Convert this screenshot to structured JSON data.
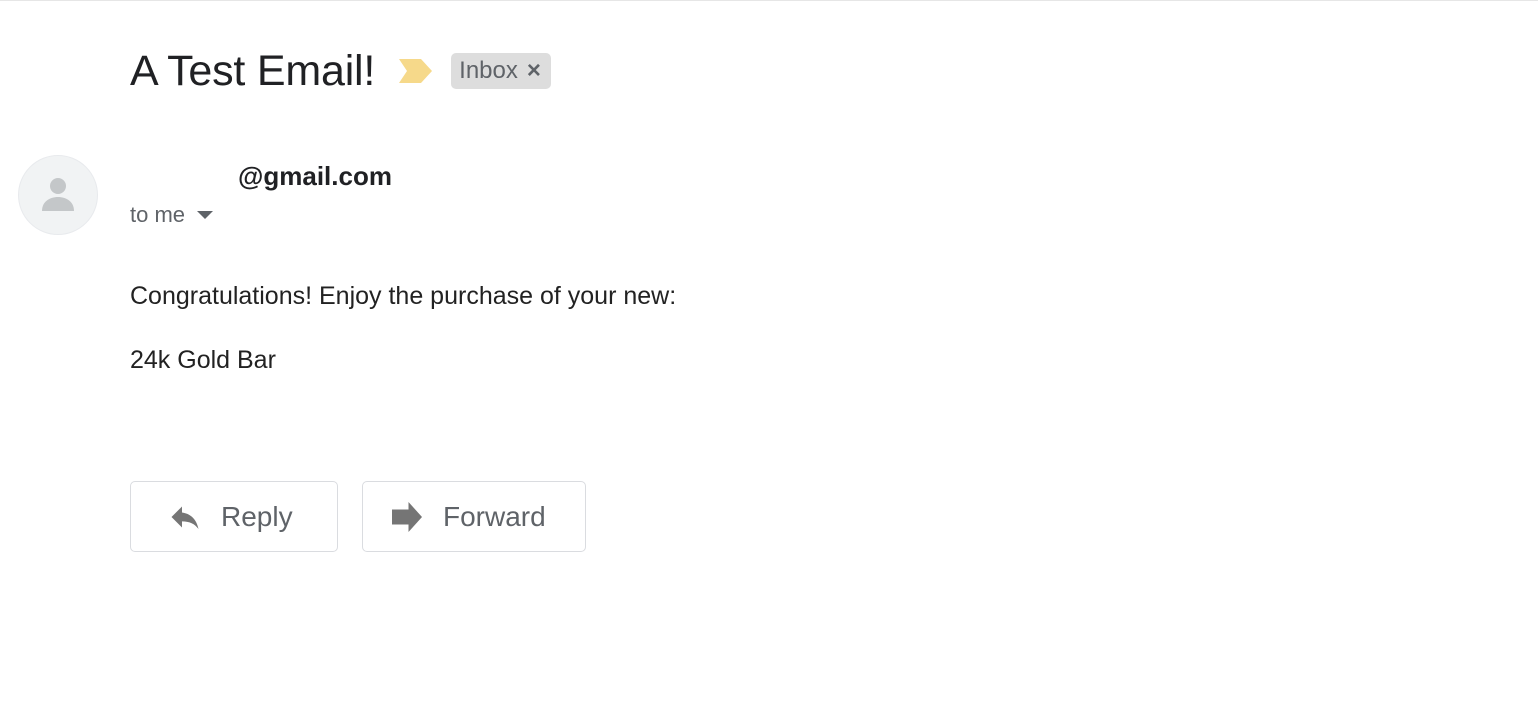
{
  "email": {
    "subject": "A Test Email!",
    "label": "Inbox",
    "label_remove_glyph": "×",
    "sender_email_visible": "@gmail.com",
    "recipient": "to me",
    "body_lines": [
      "Congratulations! Enjoy the purchase of your new:",
      "24k Gold Bar"
    ]
  },
  "actions": {
    "reply_label": "Reply",
    "forward_label": "Forward"
  },
  "icons": {
    "importance": "importance-marker-icon",
    "avatar": "person-icon",
    "recipient_details": "caret-down-icon",
    "reply": "reply-arrow-icon",
    "forward": "forward-arrow-icon"
  },
  "colors": {
    "importance_marker": "#f6d98a",
    "label_chip_bg": "#dddddd",
    "muted_text": "#5f6368",
    "icon_gray": "#757575",
    "avatar_icon": "#c4c7c9"
  }
}
